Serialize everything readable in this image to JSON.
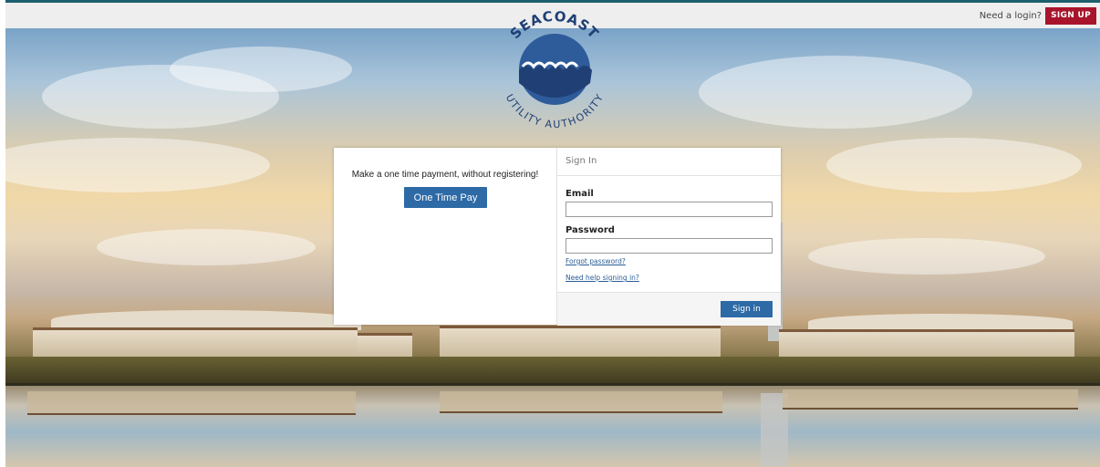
{
  "topbar": {
    "need_login": "Need a login?",
    "signup_label": "SIGN UP",
    "accent": "#a8142b"
  },
  "logo": {
    "top_text": "SEACOAST",
    "bottom_text": "UTILITY AUTHORITY",
    "color": "#2e5b9a"
  },
  "one_time": {
    "prompt": "Make a one time payment, without registering!",
    "button_label": "One Time Pay"
  },
  "signin": {
    "heading": "Sign In",
    "email_label": "Email",
    "email_value": "",
    "password_label": "Password",
    "password_value": "",
    "forgot_link": "Forgot password?",
    "help_link": "Need help signing in?",
    "button_label": "Sign in"
  },
  "colors": {
    "primary_button": "#2d6aa6",
    "link": "#2b5f98"
  }
}
